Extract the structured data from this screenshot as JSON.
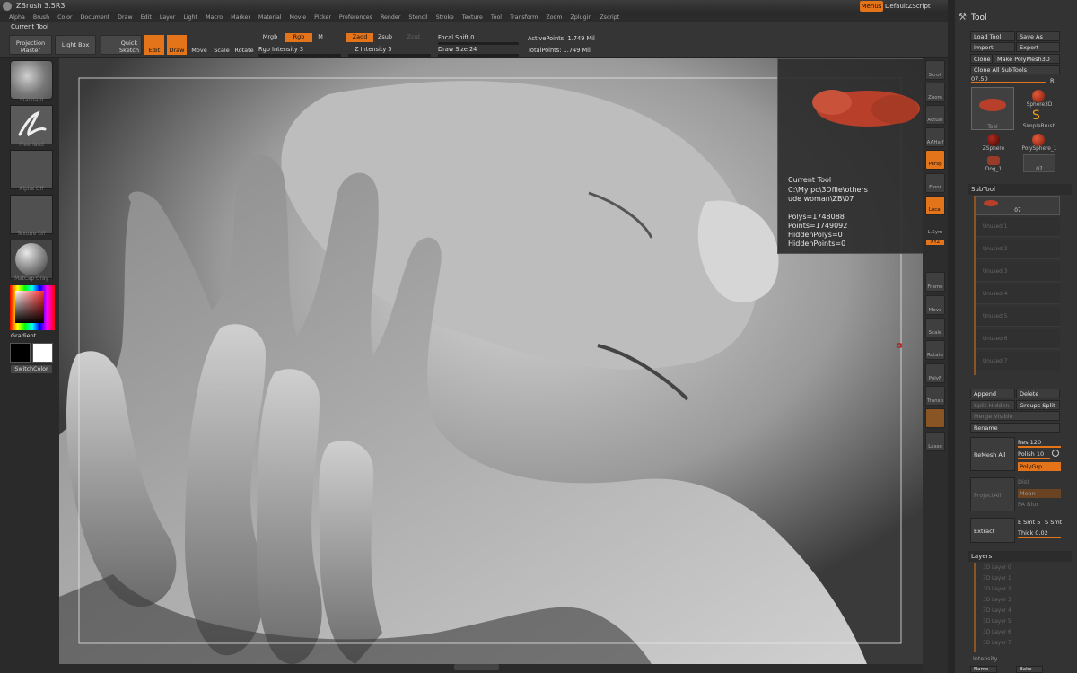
{
  "app": {
    "title": "ZBrush 3.5R3",
    "menus_button": "Menus",
    "script_label": "DefaultZScript",
    "window_controls": [
      "-",
      "□",
      "✕"
    ]
  },
  "menubar": [
    "Alpha",
    "Brush",
    "Color",
    "Document",
    "Draw",
    "Edit",
    "Layer",
    "Light",
    "Macro",
    "Marker",
    "Material",
    "Movie",
    "Picker",
    "Preferences",
    "Render",
    "Stencil",
    "Stroke",
    "Texture",
    "Tool",
    "Transform",
    "Zoom",
    "Zplugin",
    "Zscript"
  ],
  "toolbar": {
    "current_tool": "Current Tool",
    "projection_master": "Projection Master",
    "light_box": "Light Box",
    "quick_sketch": "Quick Sketch",
    "edit": "Edit",
    "draw": "Draw",
    "move": "Move",
    "scale": "Scale",
    "rotate": "Rotate",
    "mrgb": "Mrgb",
    "rgb": "Rgb",
    "m": "M",
    "rgb_intensity": "Rgb Intensity 3",
    "zadd": "Zadd",
    "zsub": "Zsub",
    "zcut": "Zcut",
    "z_intensity": "Z Intensity 5",
    "focal_shift": "Focal Shift 0",
    "draw_size": "Draw Size 24",
    "active_points": "ActivePoints: 1.749 Mil",
    "total_points": "TotalPoints: 1.749 Mil"
  },
  "leftshelf": {
    "standard": "Standard",
    "freehand": "FreeHand",
    "alpha": "Alpha Off",
    "texture": "Texture Off",
    "matcap": "MatCap Gray",
    "gradient": "Gradient",
    "switch_color": "SwitchColor"
  },
  "rightshelf": [
    "Scroll",
    "Zoom",
    "Actual",
    "AAHalf",
    "Persp",
    "Floor",
    "Local",
    "L.Sym",
    "XYZ",
    "Frame",
    "Move",
    "Scale",
    "Rotate",
    "PolyF",
    "Transp",
    "Lasso"
  ],
  "tooltip": {
    "title": "Current Tool",
    "path1": "C:\\My pc\\3Dfile\\others",
    "path2": "ude woman\\ZB\\07",
    "polys": "Polys=1748088",
    "points": "Points=1749092",
    "hidden_polys": "HiddenPolys=0",
    "hidden_points": "HiddenPoints=0"
  },
  "tray": {
    "title": "Tool",
    "load_tool": "Load Tool",
    "save_as": "Save As",
    "import": "Import",
    "export": "Export",
    "clone": "Clone",
    "make_polymesh": "Make PolyMesh3D",
    "clone_all": "Clone All SubTools",
    "value": "07.50",
    "r": "R",
    "tools": [
      "Tool",
      "Sphere3D",
      "SimpleBrush",
      "ZSphere",
      "PolySphere_1",
      "Dog_1",
      "07"
    ],
    "subtool_header": "SubTool",
    "subtool_active": "07",
    "subtool_unused": [
      "Unused 1",
      "Unused 2",
      "Unused 3",
      "Unused 4",
      "Unused 5",
      "Unused 6",
      "Unused 7"
    ],
    "append": "Append",
    "delete": "Delete",
    "split_hidden": "Split Hidden",
    "groups_split": "Groups Split",
    "merge_visible": "Merge Visible",
    "rename": "Rename",
    "remesh_all": "ReMesh All",
    "res": "Res 120",
    "polish": "Polish 10",
    "polygrp": "PolyGrp",
    "project_all": "ProjectAll",
    "dist": "Dist",
    "mean": "Mean",
    "pa_blur": "PA Blur",
    "extract": "Extract",
    "e_smt": "E Smt 5",
    "s_smt": "S Smt",
    "thick": "Thick 0.02",
    "layers_header": "Layers",
    "layers": [
      "3D Layer 0",
      "3D Layer 1",
      "3D Layer 2",
      "3D Layer 3",
      "3D Layer 4",
      "3D Layer 5",
      "3D Layer 6",
      "3D Layer 7"
    ],
    "intensity": "Intensity",
    "name": "Name",
    "bake": "Bake"
  },
  "colors": {
    "accent": "#e3741a",
    "panel": "#333333",
    "viewport": "#1c1c1c"
  }
}
